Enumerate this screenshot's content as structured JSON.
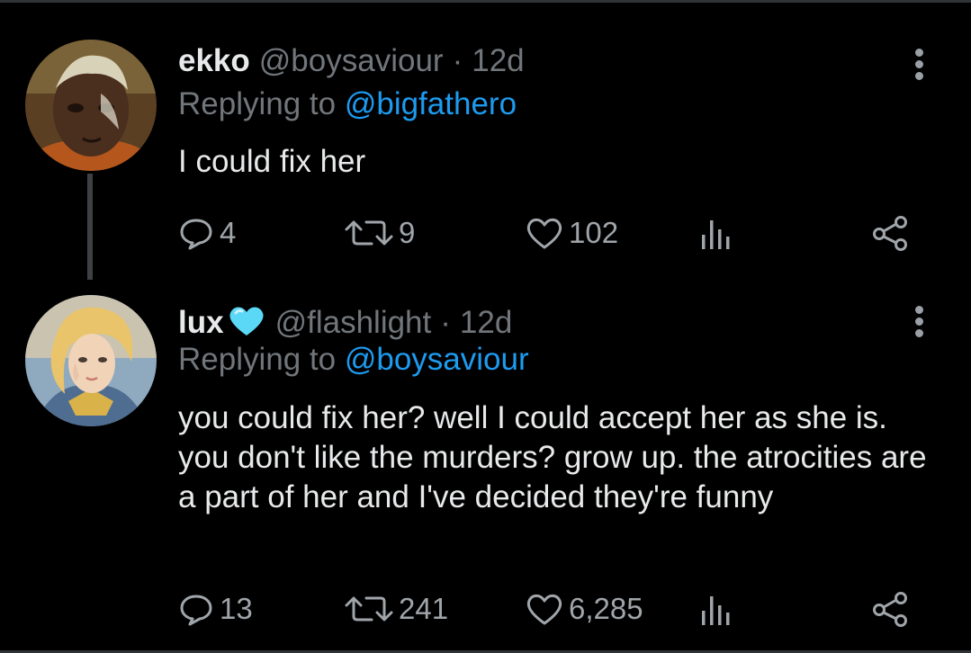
{
  "tweets": [
    {
      "name": "ekko",
      "handle": "@boysaviour",
      "separator": "·",
      "time": "12d",
      "replying_prefix": "Replying to",
      "replying_to": "@bigfathero",
      "text": "I could fix her",
      "stats": {
        "replies": "4",
        "retweets": "9",
        "likes": "102"
      }
    },
    {
      "name": "lux",
      "verified_icon": "blue-heart-icon",
      "handle": "@flashlight",
      "separator": "·",
      "time": "12d",
      "replying_prefix": "Replying to",
      "replying_to": "@boysaviour",
      "text": "you could fix her? well I could accept her as she is. you don't like the murders? grow up. the atrocities are a part of her and I've decided they're funny",
      "stats": {
        "replies": "13",
        "retweets": "241",
        "likes": "6,285"
      }
    }
  ],
  "colors": {
    "background": "#000000",
    "text": "#e7e9ea",
    "secondary": "#71767b",
    "mention": "#1d9bf0",
    "heart_badge": "#5ad8f5"
  }
}
